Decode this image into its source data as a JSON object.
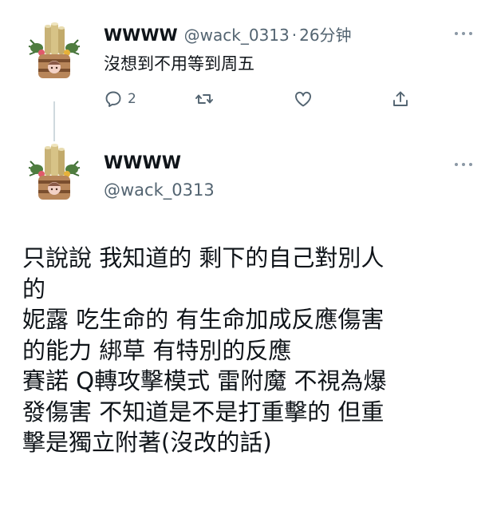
{
  "reply": {
    "display_name": "WWWW",
    "handle": "@wack_0313",
    "separator": "·",
    "time": "26分钟",
    "text": "沒想到不用等到周五",
    "reply_count": "2"
  },
  "main": {
    "display_name": "WWWW",
    "handle": "@wack_0313",
    "lines": [
      "只說說 我知道的 剩下的自己對別人",
      "的",
      "妮露 吃生命的 有生命加成反應傷害",
      "的能力 綁草 有特別的反應",
      "賽諾 Q轉攻擊模式  雷附魔 不視為爆",
      "發傷害  不知道是不是打重擊的 但重",
      "擊是獨立附著(沒改的話)"
    ]
  },
  "icons": {
    "reply": "reply-icon",
    "retweet": "retweet-icon",
    "like": "heart-icon",
    "share": "share-icon",
    "more": "more-icon"
  },
  "colors": {
    "text": "#0f1419",
    "secondary": "#536471",
    "thread_line": "#cfd9de"
  }
}
